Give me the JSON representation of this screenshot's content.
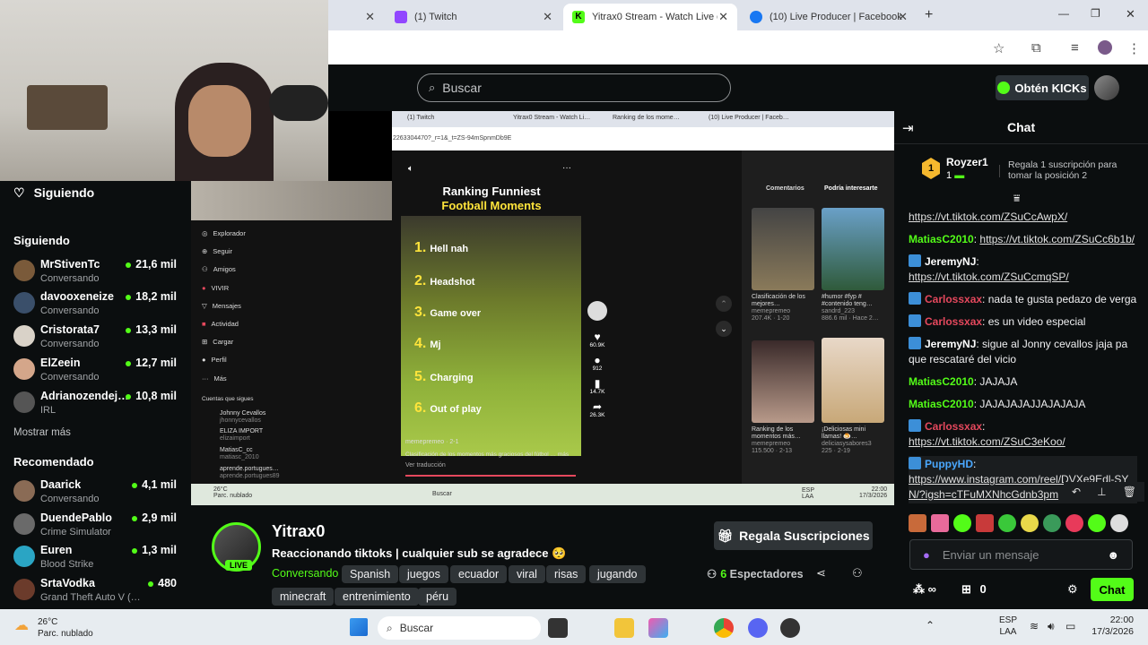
{
  "browser": {
    "tabs": [
      {
        "label": "(1) Twitch",
        "color": "#9146ff"
      },
      {
        "label": "Yitrax0 Stream - Watch Live on",
        "color": "#53fc18"
      },
      {
        "label": "(10) Live Producer | Facebook",
        "color": "#1877f2"
      }
    ],
    "new_tab": "+"
  },
  "header": {
    "search_placeholder": "Buscar",
    "get_kicks": "Obtén KICKs"
  },
  "sidebar": {
    "following_title": "Siguiendo",
    "following_section": "Siguiendo",
    "following": [
      {
        "name": "MrStivenTc",
        "category": "Conversando",
        "viewers": "21,6 mil",
        "color": "#7a5a3a"
      },
      {
        "name": "davooxeneize",
        "category": "Conversando",
        "viewers": "18,2 mil",
        "color": "#3a4f6a"
      },
      {
        "name": "Cristorata7",
        "category": "Conversando",
        "viewers": "13,3 mil",
        "color": "#d9d2c8"
      },
      {
        "name": "ElZeein",
        "category": "Conversando",
        "viewers": "12,7 mil",
        "color": "#d4a68a"
      },
      {
        "name": "Adrianozendej…",
        "category": "IRL",
        "viewers": "10,8 mil",
        "color": "#555"
      }
    ],
    "show_more": "Mostrar más",
    "recommended_section": "Recomendado",
    "recommended": [
      {
        "name": "Daarick",
        "category": "Conversando",
        "viewers": "4,1 mil",
        "color": "#8a6b55"
      },
      {
        "name": "DuendePablo",
        "category": "Crime Simulator",
        "viewers": "2,9 mil",
        "color": "#6a6a6a"
      },
      {
        "name": "Euren",
        "category": "Blood Strike",
        "viewers": "1,3 mil",
        "color": "#2aa5c4"
      },
      {
        "name": "SrtaVodka",
        "category": "Grand Theft Auto V (…",
        "viewers": "480",
        "color": "#6b3b2b"
      }
    ]
  },
  "inner": {
    "tabs": [
      "(1) Twitch",
      "Yitrax0 Stream - Watch Li…",
      "Ranking de los mome…",
      "(10) Live Producer | Faceb…"
    ],
    "url": "2263304470?_r=1&_t=ZS-94mSpnmDb9E",
    "nav": [
      "Explorador",
      "Seguir",
      "Amigos",
      "VIVIR",
      "Mensajes",
      "Actividad",
      "Cargar",
      "Perfil",
      "Más"
    ],
    "following_accounts_title": "Cuentas que sigues",
    "accounts": [
      {
        "name": "Johnny Cevallos",
        "handle": "jhonnycevallos"
      },
      {
        "name": "ELIZA IMPORT",
        "handle": "elizaimport"
      },
      {
        "name": "MatiasC_cc",
        "handle": "matiasc_2010"
      },
      {
        "name": "aprende.portugues…",
        "handle": "aprende.portugues89"
      }
    ],
    "video_title_line1": "Ranking Funniest",
    "video_title_line2": "Football Moments",
    "ranking": [
      "Hell nah",
      "Headshot",
      "Game over",
      "Mj",
      "Charging",
      "Out of play"
    ],
    "video_author": "memepremeo · 2-1",
    "video_caption": "Clasificación de los momentos más graciosos del fútbol … más",
    "see_translation": "Ver traducción",
    "actions": [
      "60.9K",
      "912",
      "14.7K",
      "26.3K"
    ],
    "right_tabs": [
      "Comentarios",
      "Podría interesarte"
    ],
    "suggested": [
      {
        "title": "Clasificación de los mejores…",
        "author": "memepremeo",
        "stats": "207.4K · 1-20"
      },
      {
        "title": "#humor #fyp # #contenido teng…",
        "author": "sandrd_223",
        "stats": "886.6 mil · Hace 2…"
      },
      {
        "title": "Ranking de los momentos más…",
        "author": "memepremeo",
        "stats": "115.500 · 2-13"
      },
      {
        "title": "¡Deliciosas mini llamas! 🍮…",
        "author": "deliciasysabores3",
        "stats": "225 · 2-19"
      }
    ],
    "weather_temp": "26°C",
    "weather_desc": "Parc. nublado",
    "search": "Buscar",
    "lang": "ESP LAA",
    "time": "22:00",
    "date": "17/3/2026"
  },
  "stream": {
    "streamer": "Yitrax0",
    "live_badge": "LIVE",
    "title": "Reaccionando tiktoks | cualquier sub se agradece 🥺",
    "category": "Conversando",
    "tags": [
      "Spanish",
      "juegos",
      "ecuador",
      "viral",
      "risas",
      "jugando",
      "minecraft",
      "entrenimiento",
      "péru"
    ],
    "gift_button": "Regala Suscripciones",
    "viewers_count": "6",
    "viewers_label": "Espectadores"
  },
  "chat": {
    "title": "Chat",
    "top_gifter": {
      "name": "Royzer1",
      "rank": "1",
      "count": "1",
      "promo": "Regala 1 suscripción para tomar la posición 2"
    },
    "messages": [
      {
        "user": "",
        "text": "https://vt.tiktok.com/ZSuCcAwpX/",
        "user_color": "#e0e0e0",
        "link": true
      },
      {
        "user": "MatiasC2010",
        "text": "https://vt.tiktok.com/ZSuCc6b1b/",
        "user_color": "#53fc18",
        "link": true
      },
      {
        "user": "JeremyNJ",
        "text": "https://vt.tiktok.com/ZSuCcmqSP/",
        "user_color": "#ffffff",
        "link": true
      },
      {
        "user": "Carlossxax",
        "text": "nada te gusta pedazo de verga",
        "user_color": "#e5485d",
        "link": false
      },
      {
        "user": "Carlossxax",
        "text": "es un video especial",
        "user_color": "#e5485d",
        "link": false
      },
      {
        "user": "JeremyNJ",
        "text": "sigue al Jonny cevallos jaja pa que rescataré del vicio",
        "user_color": "#ffffff",
        "link": false
      },
      {
        "user": "MatiasC2010",
        "text": "JAJAJA",
        "user_color": "#53fc18",
        "link": false
      },
      {
        "user": "MatiasC2010",
        "text": "JAJAJAJAJJAJAJAJA",
        "user_color": "#53fc18",
        "link": false
      },
      {
        "user": "Carlossxax",
        "text": "https://vt.tiktok.com/ZSuC3eKoo/",
        "user_color": "#e5485d",
        "link": true
      },
      {
        "user": "PuppyHD",
        "text": "https://www.instagram.com/reel/DVXe9Edl-SYN/?igsh=cTFuMXNhcGdnb3pm",
        "user_color": "#4aa8ff",
        "link": true
      }
    ],
    "input_placeholder": "Enviar un mensaje",
    "points": "∞",
    "kicks": "0",
    "send_button": "Chat"
  },
  "taskbar": {
    "weather_temp": "26°C",
    "weather_desc": "Parc. nublado",
    "search": "Buscar",
    "lang_1": "ESP",
    "lang_2": "LAA",
    "time": "22:00",
    "date": "17/3/2026"
  },
  "colors": {
    "accent": "#53fc18",
    "bg": "#0b0e0f",
    "chip": "#2f3437"
  }
}
